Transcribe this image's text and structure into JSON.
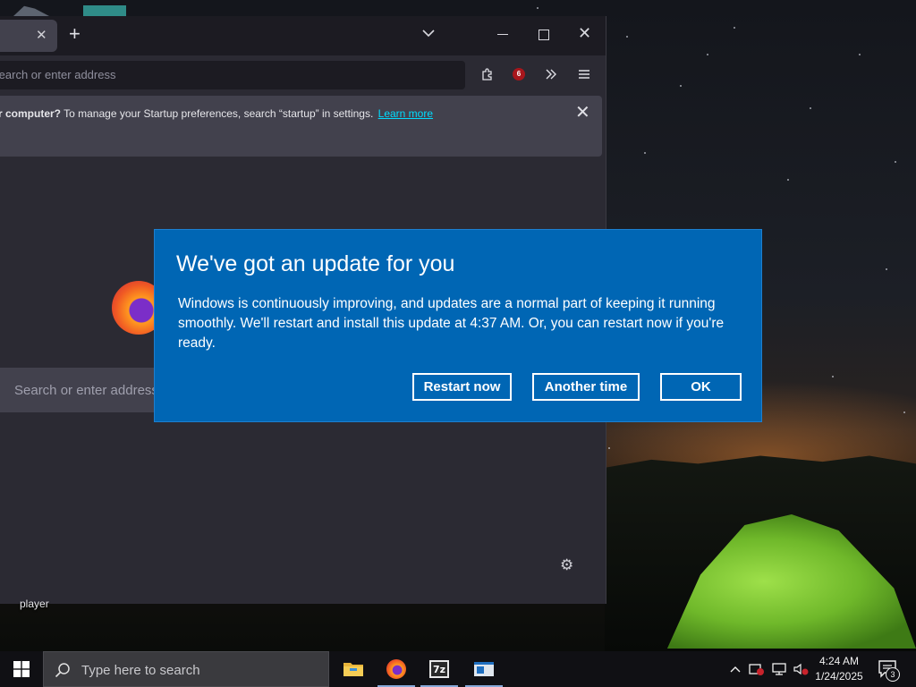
{
  "browser": {
    "urlbar_placeholder": "Search or enter address",
    "extension_badge": "6",
    "notification": {
      "bold_text": "r computer?",
      "text": " To manage your Startup preferences, search “startup” in settings.",
      "link": "Learn more"
    },
    "newtab_search_placeholder": "Search or enter address"
  },
  "desktop": {
    "label": "player"
  },
  "dialog": {
    "title": "We've got an update for you",
    "body": "Windows is continuously improving, and updates are a normal part of keeping it running smoothly. We'll restart and install this update at 4:37 AM. Or, you can restart now if you're ready.",
    "buttons": {
      "restart": "Restart now",
      "another_time": "Another time",
      "ok": "OK"
    },
    "color": "#0066b4"
  },
  "taskbar": {
    "search_placeholder": "Type here to search",
    "pinned": [
      "file-explorer-icon",
      "firefox-icon",
      "7zip-icon",
      "window-app-icon"
    ],
    "clock_time": "4:24 AM",
    "clock_date": "1/24/2025",
    "notification_count": "3"
  }
}
